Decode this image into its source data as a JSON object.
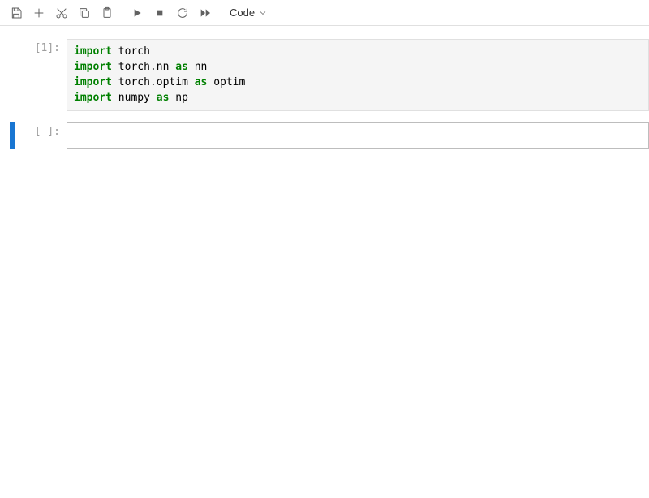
{
  "toolbar": {
    "cell_type_label": "Code"
  },
  "cells": [
    {
      "prompt": "[1]:",
      "executed": true,
      "active": false,
      "code": [
        [
          {
            "t": "kw",
            "v": "import"
          },
          {
            "t": "sp",
            "v": " "
          },
          {
            "t": "nm",
            "v": "torch"
          }
        ],
        [
          {
            "t": "kw",
            "v": "import"
          },
          {
            "t": "sp",
            "v": " "
          },
          {
            "t": "nm",
            "v": "torch.nn"
          },
          {
            "t": "sp",
            "v": " "
          },
          {
            "t": "kw",
            "v": "as"
          },
          {
            "t": "sp",
            "v": " "
          },
          {
            "t": "nm",
            "v": "nn"
          }
        ],
        [
          {
            "t": "kw",
            "v": "import"
          },
          {
            "t": "sp",
            "v": " "
          },
          {
            "t": "nm",
            "v": "torch.optim"
          },
          {
            "t": "sp",
            "v": " "
          },
          {
            "t": "kw",
            "v": "as"
          },
          {
            "t": "sp",
            "v": " "
          },
          {
            "t": "nm",
            "v": "optim"
          }
        ],
        [
          {
            "t": "kw",
            "v": "import"
          },
          {
            "t": "sp",
            "v": " "
          },
          {
            "t": "nm",
            "v": "numpy"
          },
          {
            "t": "sp",
            "v": " "
          },
          {
            "t": "kw",
            "v": "as"
          },
          {
            "t": "sp",
            "v": " "
          },
          {
            "t": "nm",
            "v": "np"
          }
        ]
      ]
    },
    {
      "prompt": "[ ]:",
      "executed": false,
      "active": true,
      "code": []
    }
  ]
}
